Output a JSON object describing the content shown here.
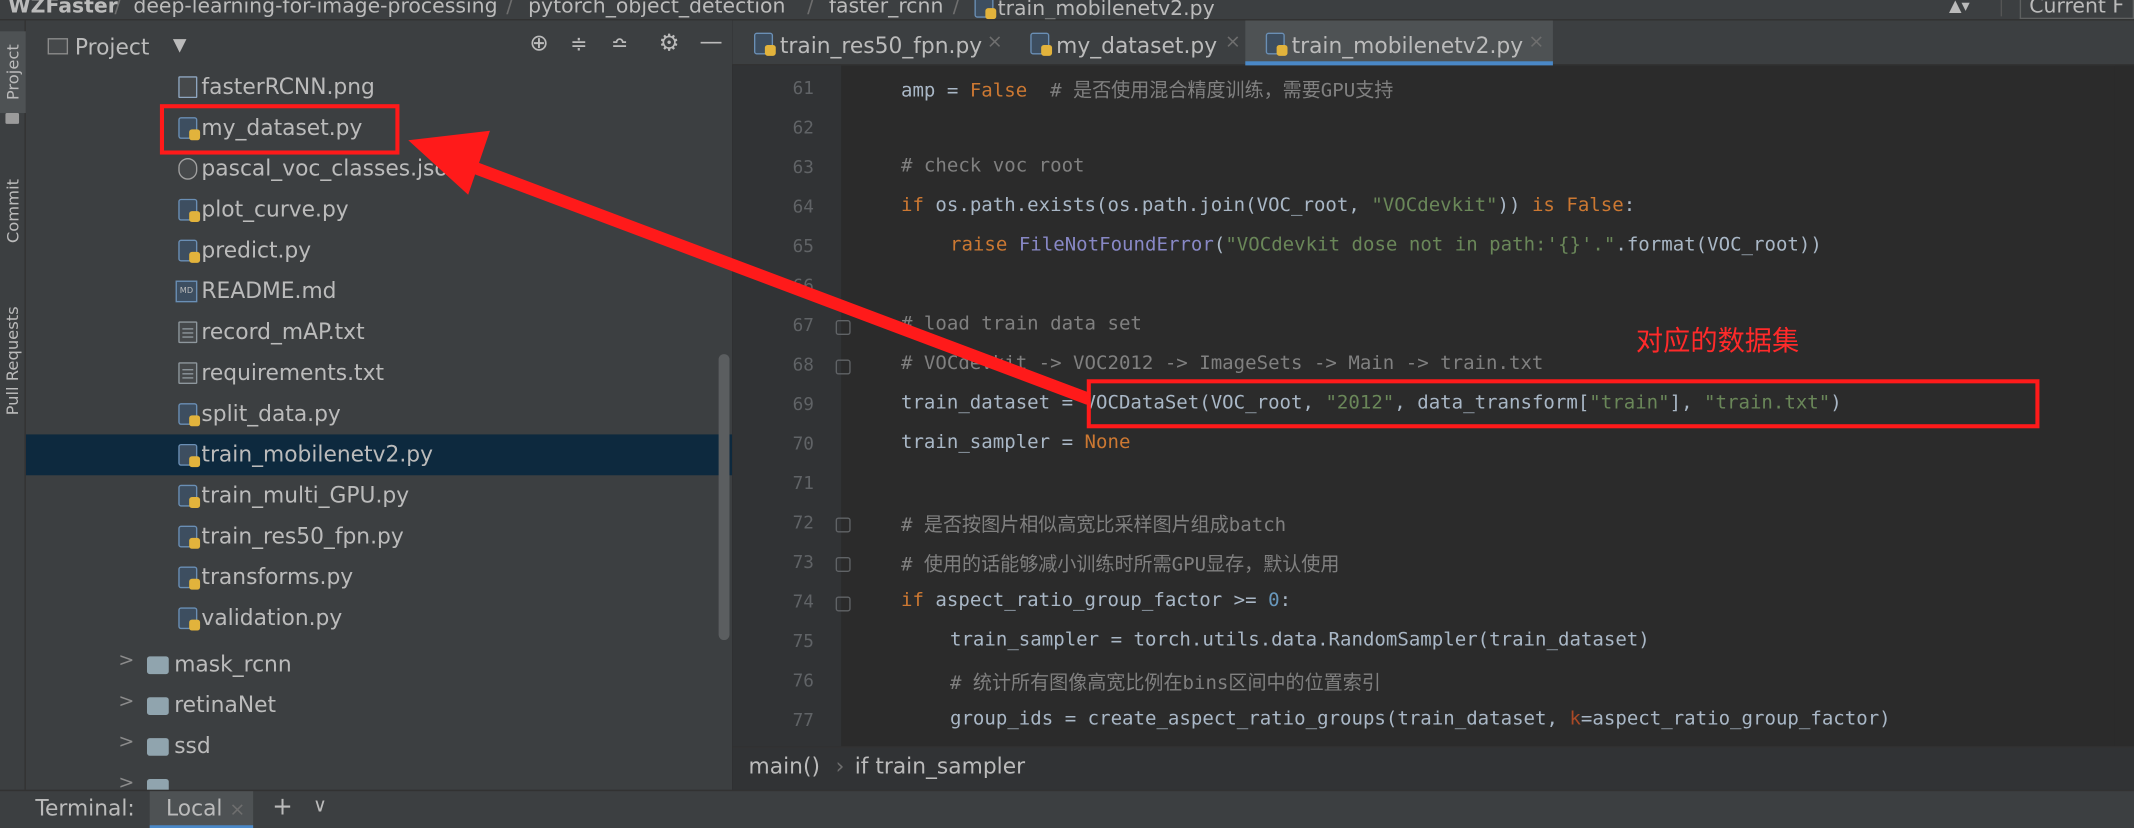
{
  "navbar": {
    "crumbs": [
      "WZFaster",
      "deep-learning-for-image-processing",
      "pytorch_object_detection",
      "faster_rcnn",
      "train_mobilenetv2.py"
    ],
    "right_label": "Current F"
  },
  "left_strip": {
    "tabs": [
      "Project",
      "Commit",
      "Pull Requests"
    ]
  },
  "project_panel": {
    "title": "Project",
    "files": [
      {
        "name": "fasterRCNN.png",
        "icon": "image-file-icon"
      },
      {
        "name": "my_dataset.py",
        "icon": "python-file-icon"
      },
      {
        "name": "pascal_voc_classes.json",
        "icon": "json-file-icon"
      },
      {
        "name": "plot_curve.py",
        "icon": "python-file-icon"
      },
      {
        "name": "predict.py",
        "icon": "python-file-icon"
      },
      {
        "name": "README.md",
        "icon": "markdown-file-icon"
      },
      {
        "name": "record_mAP.txt",
        "icon": "text-file-icon"
      },
      {
        "name": "requirements.txt",
        "icon": "text-file-icon"
      },
      {
        "name": "split_data.py",
        "icon": "python-file-icon"
      },
      {
        "name": "train_mobilenetv2.py",
        "icon": "python-file-icon"
      },
      {
        "name": "train_multi_GPU.py",
        "icon": "python-file-icon"
      },
      {
        "name": "train_res50_fpn.py",
        "icon": "python-file-icon"
      },
      {
        "name": "transforms.py",
        "icon": "python-file-icon"
      },
      {
        "name": "validation.py",
        "icon": "python-file-icon"
      }
    ],
    "folders": [
      "mask_rcnn",
      "retinaNet",
      "ssd"
    ],
    "selected": "train_mobilenetv2.py"
  },
  "editor": {
    "tabs": [
      {
        "label": "train_res50_fpn.py",
        "active": false
      },
      {
        "label": "my_dataset.py",
        "active": false
      },
      {
        "label": "train_mobilenetv2.py",
        "active": true
      }
    ],
    "line_numbers": [
      "61",
      "62",
      "63",
      "64",
      "65",
      "66",
      "67",
      "68",
      "69",
      "70",
      "71",
      "72",
      "73",
      "74",
      "75",
      "76",
      "77"
    ],
    "code": {
      "l61_a": "amp = ",
      "l61_b": "False",
      "l61_c": "  # 是否使用混合精度训练，需要GPU支持",
      "l63": "# check voc root",
      "l64_a": "if",
      "l64_b": " os.path.exists(os.path.join(VOC_root, ",
      "l64_c": "\"VOCdevkit\"",
      "l64_d": ")) ",
      "l64_e": "is False",
      "l64_f": ":",
      "l65_a": "raise ",
      "l65_b": "FileNotFoundError",
      "l65_c": "(",
      "l65_d": "\"VOCdevkit dose not in path:'{}'.\"",
      "l65_e": ".format(VOC_root))",
      "l67": "# load train data set",
      "l68": "# VOCdevkit -> VOC2012 -> ImageSets -> Main -> train.txt",
      "l69_a": "train_dataset = VOCDataSet(VOC_root, ",
      "l69_b": "\"2012\"",
      "l69_c": ", data_transform[",
      "l69_d": "\"train\"",
      "l69_e": "], ",
      "l69_f": "\"train.txt\"",
      "l69_g": ")",
      "l70_a": "train_sampler = ",
      "l70_b": "None",
      "l72": "# 是否按图片相似高宽比采样图片组成batch",
      "l73": "# 使用的话能够减小训练时所需GPU显存，默认使用",
      "l74_a": "if",
      "l74_b": " aspect_ratio_group_factor >= ",
      "l74_c": "0",
      "l74_d": ":",
      "l75": "train_sampler = torch.utils.data.RandomSampler(train_dataset)",
      "l76": "# 统计所有图像高宽比例在bins区间中的位置索引",
      "l77_a": "group_ids = create_aspect_ratio_groups(train_dataset, ",
      "l77_b": "k",
      "l77_c": "=aspect_ratio_group_factor)"
    },
    "breadcrumb": [
      "main()",
      "if train_sampler"
    ]
  },
  "terminal": {
    "label": "Terminal:",
    "tab": "Local"
  },
  "annotation": {
    "text": "对应的数据集",
    "color": "#ff2a2a"
  },
  "colors": {
    "selection": "#0d293e",
    "accent": "#4a88c7",
    "keyword": "#cc7832",
    "string": "#6a8759",
    "comment": "#808080"
  }
}
